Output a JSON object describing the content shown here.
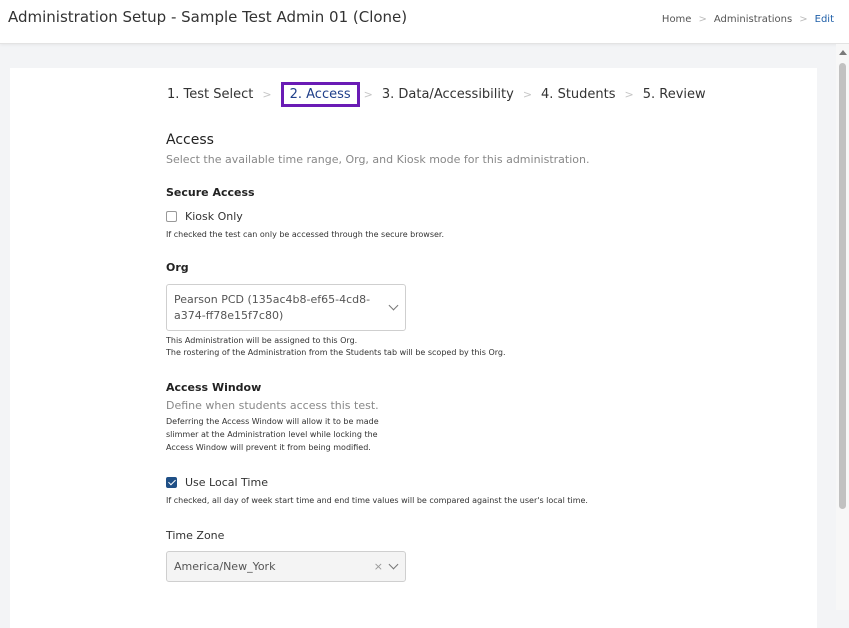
{
  "header": {
    "title": "Administration Setup  - Sample Test Admin 01 (Clone)",
    "breadcrumb": [
      "Home",
      "Administrations",
      "Edit"
    ]
  },
  "steps": [
    {
      "label": "1. Test Select"
    },
    {
      "label": "2. Access",
      "active": true
    },
    {
      "label": "3. Data/Accessibility"
    },
    {
      "label": "4. Students"
    },
    {
      "label": "5. Review"
    }
  ],
  "access": {
    "title": "Access",
    "subtitle": "Select the available time range, Org, and Kiosk mode for this administration."
  },
  "secure_access": {
    "label": "Secure Access",
    "kiosk_label": "Kiosk Only",
    "kiosk_checked": false,
    "kiosk_help": "If checked the test can only be accessed through the secure browser."
  },
  "org": {
    "label": "Org",
    "value_line1": "Pearson PCD (135ac4b8-ef65-4cd8-",
    "value_line2": "a374-ff78e15f7c80)",
    "help1": "This Administration will be assigned to this Org.",
    "help2": "The rostering of the Administration from the Students tab will be scoped by this Org."
  },
  "access_window": {
    "label": "Access Window",
    "subtitle": "Define when students access this test.",
    "help1": "Deferring the Access Window will allow it to be made",
    "help2": "slimmer at the Administration level while locking the",
    "help3": "Access Window will prevent it from being modified."
  },
  "local_time": {
    "label": "Use Local Time",
    "checked": true,
    "help": "If checked, all day of week start time and end time values will be compared against the user's local time."
  },
  "time_zone": {
    "label": "Time Zone",
    "value": "America/New_York",
    "clear": "×"
  },
  "colors": {
    "accent": "#6a1bb5",
    "primary": "#1f4f86",
    "link": "#1f5fa8"
  }
}
